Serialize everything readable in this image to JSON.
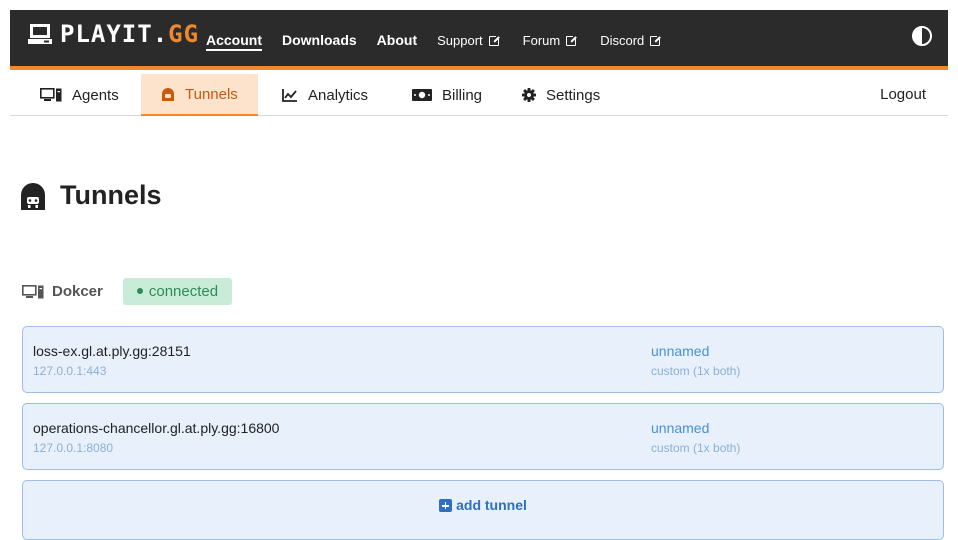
{
  "brand": {
    "name_main": "PLAYIT.",
    "name_accent": "GG",
    "accent_color": "#f0882e"
  },
  "topnav": {
    "items": [
      {
        "label": "Account",
        "active": true
      },
      {
        "label": "Downloads"
      },
      {
        "label": "About"
      },
      {
        "label": "Support",
        "external": true
      },
      {
        "label": "Forum",
        "external": true
      },
      {
        "label": "Discord",
        "external": true
      }
    ]
  },
  "subnav": {
    "items": [
      {
        "label": "Agents",
        "icon": "monitor-icon"
      },
      {
        "label": "Tunnels",
        "icon": "tunnel-icon",
        "active": true
      },
      {
        "label": "Analytics",
        "icon": "chart-line-icon"
      },
      {
        "label": "Billing",
        "icon": "money-bill-icon"
      },
      {
        "label": "Settings",
        "icon": "gear-icon"
      }
    ],
    "logout": "Logout"
  },
  "page": {
    "title": "Tunnels"
  },
  "agent": {
    "name": "Dokcer",
    "status": "connected",
    "status_color": "#2e8b57"
  },
  "tunnels": [
    {
      "address": "loss-ex.gl.at.ply.gg:28151",
      "local": "127.0.0.1:443",
      "name": "unnamed",
      "type": "custom (1x both)"
    },
    {
      "address": "operations-chancellor.gl.at.ply.gg:16800",
      "local": "127.0.0.1:8080",
      "name": "unnamed",
      "type": "custom (1x both)"
    }
  ],
  "add_tunnel": {
    "label": "add tunnel"
  }
}
